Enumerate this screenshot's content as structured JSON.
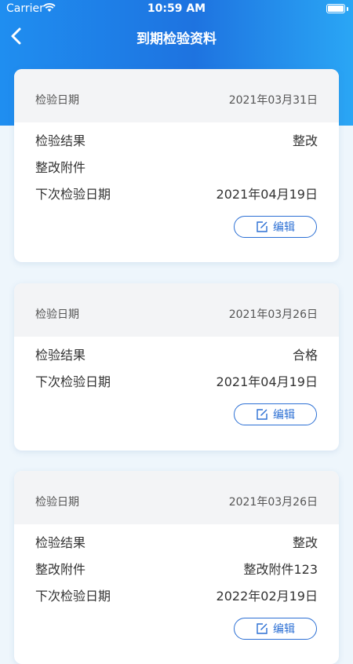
{
  "status_bar": {
    "carrier": "Carrier",
    "time": "10:59 AM"
  },
  "nav": {
    "title": "到期检验资料"
  },
  "records": [
    {
      "date_label": "检验日期",
      "date": "2021年03月31日",
      "rows": [
        {
          "label": "检验结果",
          "value": "整改"
        },
        {
          "label": "整改附件",
          "value": ""
        },
        {
          "label": "下次检验日期",
          "value": "2021年04月19日"
        }
      ],
      "edit_label": "编辑"
    },
    {
      "date_label": "检验日期",
      "date": "2021年03月26日",
      "rows": [
        {
          "label": "检验结果",
          "value": "合格"
        },
        {
          "label": "下次检验日期",
          "value": "2021年04月19日"
        }
      ],
      "edit_label": "编辑"
    },
    {
      "date_label": "检验日期",
      "date": "2021年03月26日",
      "rows": [
        {
          "label": "检验结果",
          "value": "整改"
        },
        {
          "label": "整改附件",
          "value": "整改附件123"
        },
        {
          "label": "下次检验日期",
          "value": "2022年02月19日"
        }
      ],
      "edit_label": "编辑"
    }
  ]
}
